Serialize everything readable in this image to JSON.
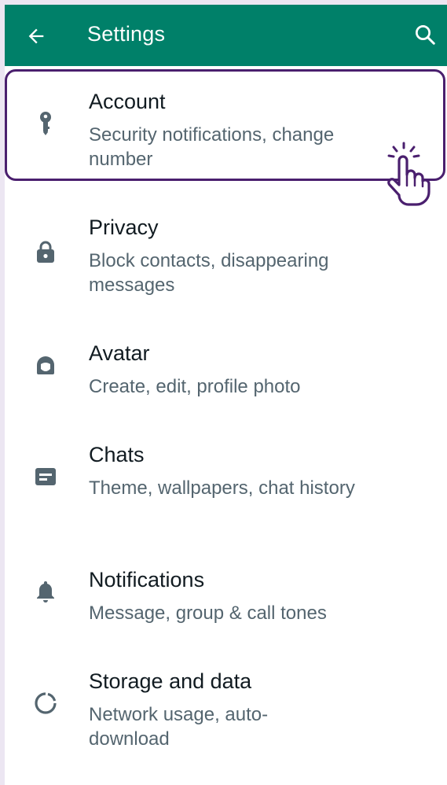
{
  "header": {
    "title": "Settings",
    "back_icon": "arrow-left-icon",
    "search_icon": "search-icon",
    "bg_color": "#008069"
  },
  "items": [
    {
      "label": "Account",
      "subtitle": "Security notifications, change number",
      "icon": "key-icon"
    },
    {
      "label": "Privacy",
      "subtitle": "Block contacts, disappearing messages",
      "icon": "lock-icon"
    },
    {
      "label": "Avatar",
      "subtitle": "Create, edit, profile photo",
      "icon": "avatar-icon"
    },
    {
      "label": "Chats",
      "subtitle": "Theme, wallpapers, chat history",
      "icon": "chat-icon"
    },
    {
      "label": "Notifications",
      "subtitle": "Message, group & call tones",
      "icon": "bell-icon"
    },
    {
      "label": "Storage and data",
      "subtitle": "Network usage, auto-download",
      "icon": "storage-icon"
    }
  ],
  "highlight_color": "#4a1f6e",
  "icon_color": "#54656f"
}
